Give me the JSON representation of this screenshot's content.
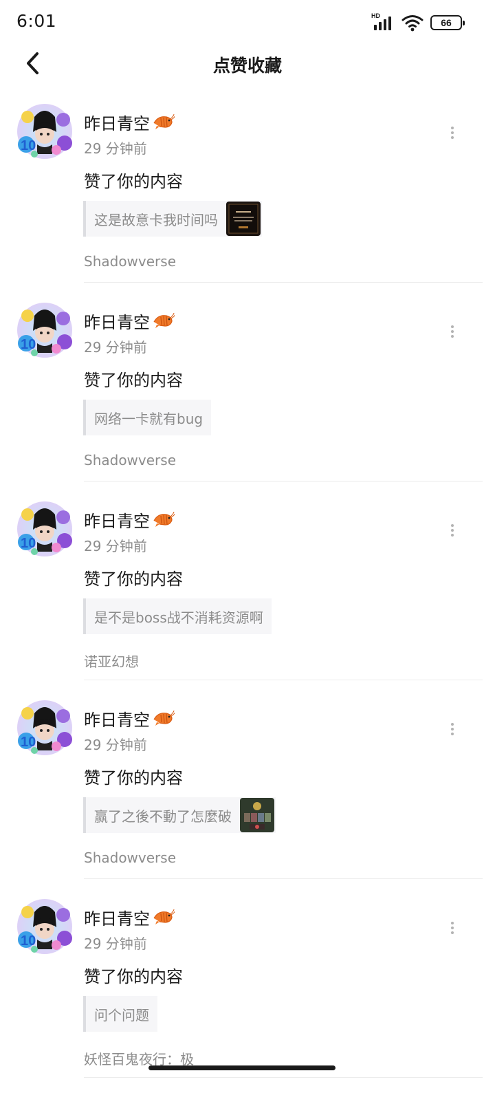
{
  "status_bar": {
    "time": "6:01",
    "hd_label": "HD",
    "battery": "66"
  },
  "header": {
    "title": "点赞收藏"
  },
  "notifications": [
    {
      "user": "昨日青空",
      "time_ago": "29 分钟前",
      "action": "赞了你的内容",
      "quote": "这是故意卡我时间吗",
      "has_thumb": true,
      "game": "Shadowverse"
    },
    {
      "user": "昨日青空",
      "time_ago": "29 分钟前",
      "action": "赞了你的内容",
      "quote": "网络一卡就有bug",
      "has_thumb": false,
      "game": "Shadowverse"
    },
    {
      "user": "昨日青空",
      "time_ago": "29 分钟前",
      "action": "赞了你的内容",
      "quote": "是不是boss战不消耗资源啊",
      "has_thumb": false,
      "game": "诺亚幻想"
    },
    {
      "user": "昨日青空",
      "time_ago": "29 分钟前",
      "action": "赞了你的内容",
      "quote": "赢了之後不動了怎麼破",
      "has_thumb": true,
      "game": "Shadowverse"
    },
    {
      "user": "昨日青空",
      "time_ago": "29 分钟前",
      "action": "赞了你的内容",
      "quote": "问个问题",
      "has_thumb": false,
      "game": "妖怪百鬼夜行：极"
    }
  ],
  "icons": {
    "back": "chevron-left-icon",
    "more": "more-vertical-icon",
    "badge": "shrimp-icon"
  },
  "colors": {
    "text_primary": "#1a1a1a",
    "text_secondary": "#8c8c8c",
    "quote_bg": "#f6f6f8"
  }
}
